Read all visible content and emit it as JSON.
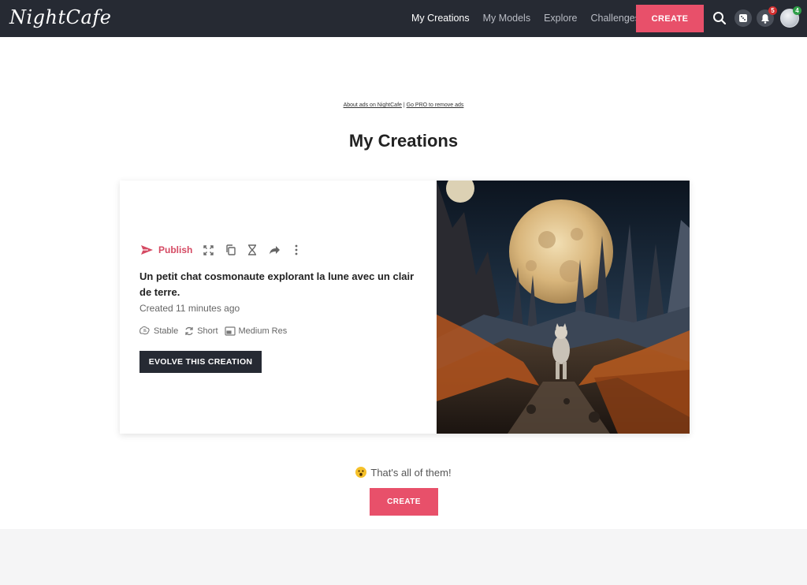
{
  "header": {
    "logo_text": "NightCafe",
    "nav": [
      "My Creations",
      "My Models",
      "Explore",
      "Challenges"
    ],
    "create_label": "CREATE",
    "notification_count": "5",
    "avatar_count": "4"
  },
  "ads": {
    "about_label": "About ads on NightCafe",
    "separator": "|",
    "pro_label": "Go PRO to remove ads"
  },
  "page": {
    "title": "My Creations"
  },
  "creation": {
    "publish_label": "Publish",
    "prompt": "Un petit chat cosmonaute explorant la lune avec un clair de terre.",
    "created": "Created 11 minutes ago",
    "model": "Stable",
    "duration": "Short",
    "resolution": "Medium Res",
    "evolve_label": "EVOLVE THIS CREATION",
    "image_icon": "cat-astronaut-moon-image"
  },
  "footer": {
    "done_text": "That's all of them!",
    "create_label": "CREATE"
  },
  "colors": {
    "accent": "#e8506a",
    "dark": "#262a33",
    "publish": "#d54a63"
  }
}
